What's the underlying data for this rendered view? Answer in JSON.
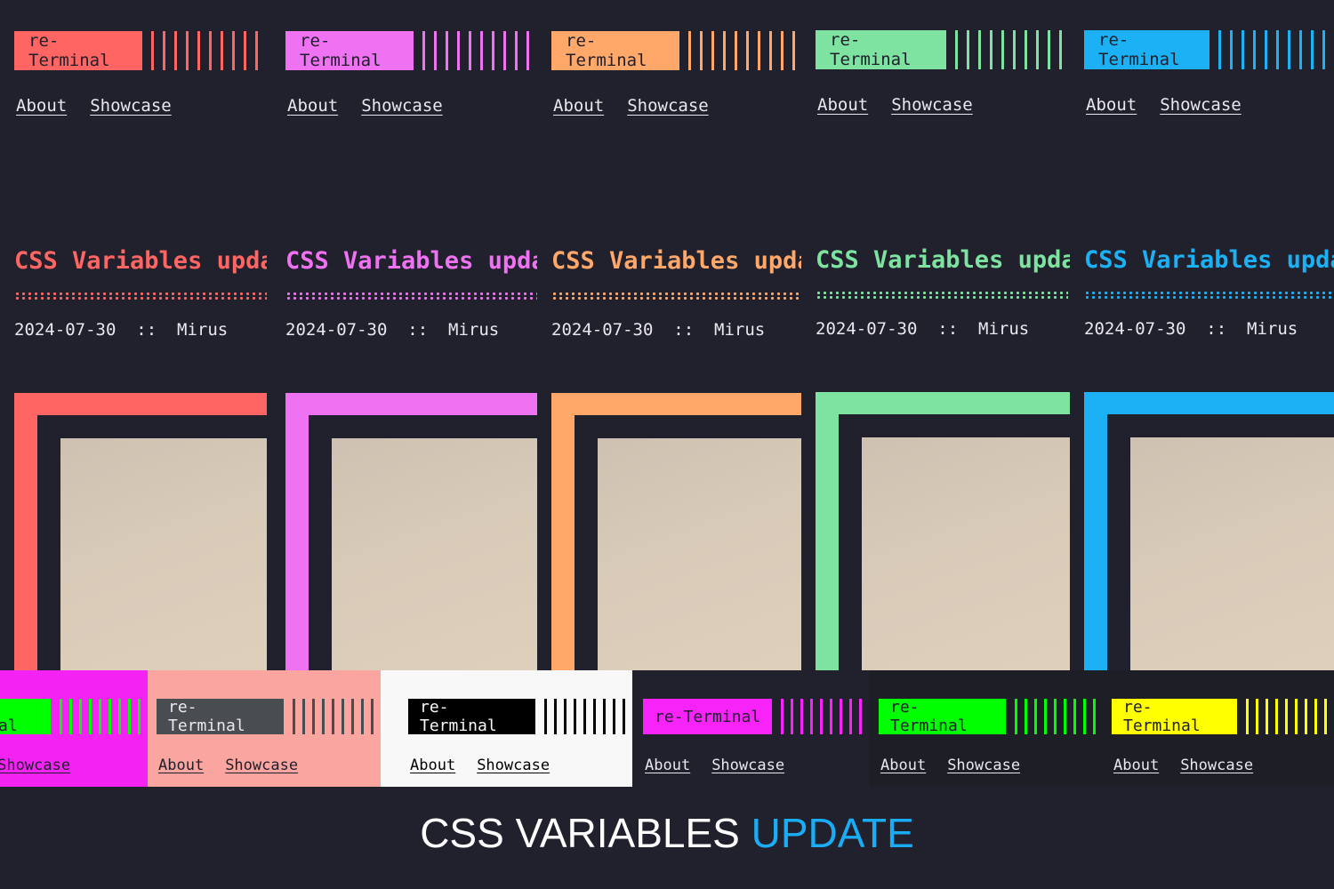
{
  "brand": "re-Terminal",
  "nav": [
    "About",
    "Showcase"
  ],
  "post": {
    "title": "CSS Variables update",
    "date": "2024-07-30",
    "separator": "::",
    "author": "Mirus"
  },
  "themes": [
    {
      "accent": "#ff6562"
    },
    {
      "accent": "#ee72f1"
    },
    {
      "accent": "#ffa86a"
    },
    {
      "accent": "#7ee3a0"
    },
    {
      "accent": "#1cb1f5"
    }
  ],
  "strips": [
    {
      "bg": "#f423f4",
      "accent": "#00ff00",
      "logo_text": "#21202d",
      "link": "#21202d"
    },
    {
      "bg": "#faa59f",
      "accent": "#4a4d4f",
      "logo_text": "#e8e8ee",
      "link": "#21202d"
    },
    {
      "bg": "#f8f8f8",
      "accent": "#000000",
      "logo_text": "#f8f8f8",
      "link": "#000000"
    },
    {
      "bg": "#21202d",
      "accent": "#f823f8",
      "logo_text": "#21202d",
      "link": "#e8e8ee"
    },
    {
      "bg": "#1e1e26",
      "accent": "#00ff00",
      "logo_text": "#21202d",
      "link": "#e8e8ee"
    },
    {
      "bg": "#1e1e26",
      "accent": "#ffff00",
      "logo_text": "#21202d",
      "link": "#e8e8ee"
    }
  ],
  "footer": {
    "title_main": "CSS VARIABLES",
    "title_accent": "UPDATE"
  }
}
